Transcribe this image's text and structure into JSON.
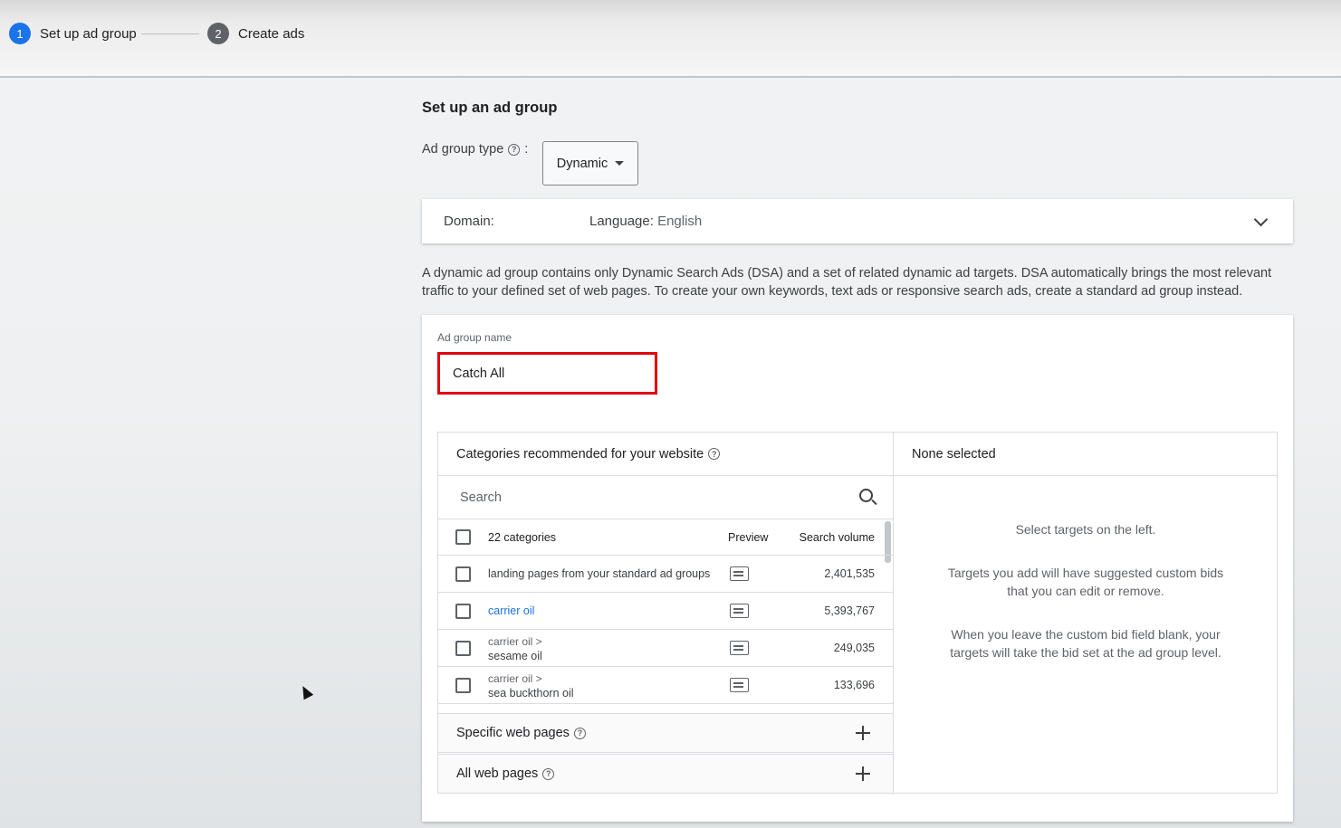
{
  "stepper": {
    "step1": {
      "number": "1",
      "label": "Set up ad group"
    },
    "step2": {
      "number": "2",
      "label": "Create ads"
    }
  },
  "page_title": "Set up an ad group",
  "ad_group_type": {
    "label": "Ad group type",
    "separator": ":",
    "value": "Dynamic"
  },
  "domain_bar": {
    "domain_label": "Domain:",
    "language_label": "Language:",
    "language_value": "English"
  },
  "description": "A dynamic ad group contains only Dynamic Search Ads (DSA) and a set of related dynamic ad targets. DSA automatically brings the most relevant traffic to your defined set of web pages. To create your own keywords, text ads or responsive search ads, create a standard ad group instead.",
  "ad_group_name": {
    "label": "Ad group name",
    "value": "Catch All"
  },
  "categories_panel": {
    "title": "Categories recommended for your website",
    "search_placeholder": "Search",
    "headers": {
      "categories": "22 categories",
      "preview": "Preview",
      "search_volume": "Search volume"
    },
    "rows": [
      {
        "parent": "",
        "name": "landing pages from your standard ad groups",
        "volume": "2,401,535",
        "link": false
      },
      {
        "parent": "",
        "name": "carrier oil",
        "volume": "5,393,767",
        "link": true
      },
      {
        "parent": "carrier oil >",
        "name": "sesame oil",
        "volume": "249,035",
        "link": false
      },
      {
        "parent": "carrier oil >",
        "name": "sea buckthorn oil",
        "volume": "133,696",
        "link": false
      }
    ],
    "specific_web_pages": "Specific web pages",
    "all_web_pages": "All web pages"
  },
  "selected_panel": {
    "title": "None selected",
    "line1": "Select targets on the left.",
    "line2": "Targets you add will have suggested custom bids that you can edit or remove.",
    "line3": "When you leave the custom bid field blank, your targets will take the bid set at the ad group level."
  },
  "colors": {
    "primary": "#1a73e8",
    "highlight_border": "#e1000f"
  }
}
